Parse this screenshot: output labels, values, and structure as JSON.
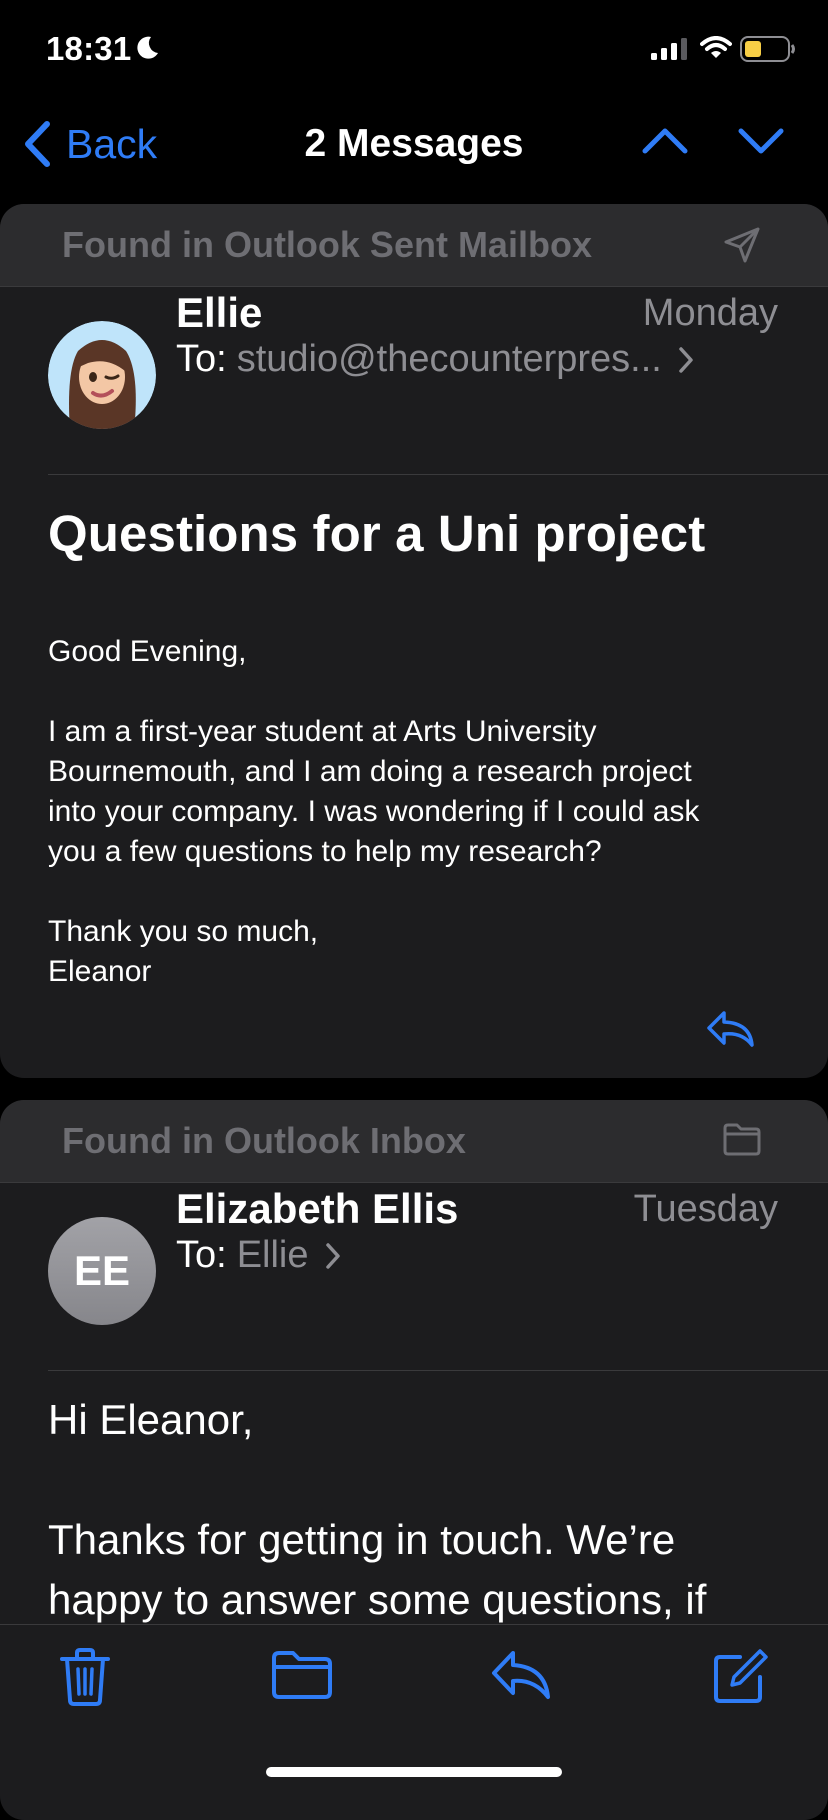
{
  "status_bar": {
    "time": "18:31",
    "icons": [
      "moon-icon",
      "cellular-signal-icon",
      "wifi-icon",
      "battery-low-power-icon"
    ]
  },
  "nav": {
    "back_label": "Back",
    "title": "2 Messages",
    "icons": [
      "chevron-left-icon",
      "chevron-up-icon",
      "chevron-down-icon"
    ]
  },
  "messages": [
    {
      "mailbox": "Found in Outlook Sent Mailbox",
      "mailbox_icon": "paper-plane-icon",
      "sender": "Ellie",
      "date": "Monday",
      "to_label": "To:",
      "to_value": "studio@thecounterpres...",
      "subject": "Questions for a Uni project",
      "body": [
        "Good Evening,",
        "I am a first-year student at Arts University\nBournemouth, and I am doing a research project\ninto your company. I was wondering if I could ask\nyou a few questions to help my research?",
        "Thank you so much,\nEleanor"
      ]
    },
    {
      "mailbox": "Found in Outlook Inbox",
      "mailbox_icon": "folder-icon",
      "sender": "Elizabeth Ellis",
      "initials": "EE",
      "date": "Tuesday",
      "to_label": "To:",
      "to_value": "Ellie",
      "body": [
        "Hi Eleanor,",
        "Thanks for getting in touch. We’re\nhappy to answer some questions, if"
      ]
    }
  ],
  "toolbar": {
    "icons": [
      "trash-icon",
      "folder-icon",
      "reply-icon",
      "compose-icon"
    ]
  },
  "colors": {
    "accent": "#2f7cf6",
    "background": "#000000",
    "card": "#1c1c1e",
    "mailbox_bar": "#2c2c2e",
    "secondary_text": "#8e8e93",
    "battery_fill": "#f7ce46"
  }
}
